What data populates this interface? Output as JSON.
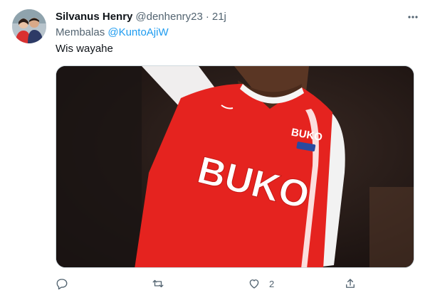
{
  "tweet": {
    "display_name": "Silvanus Henry",
    "handle": "@denhenry23",
    "separator": "·",
    "time": "21j",
    "reply_prefix": "Membalas ",
    "reply_mention": "@KuntoAjiW",
    "text": "Wis wayahe",
    "media": {
      "jersey_text": "BUKO",
      "badge_text": "BUKO"
    },
    "actions": {
      "reply_count": "",
      "retweet_count": "",
      "like_count": "2",
      "share_count": ""
    }
  },
  "colors": {
    "accent": "#1d9bf0",
    "secondary_text": "#536471",
    "jersey_red": "#e5231f"
  },
  "icons": [
    "more-icon",
    "reply-icon",
    "retweet-icon",
    "like-icon",
    "share-icon"
  ]
}
